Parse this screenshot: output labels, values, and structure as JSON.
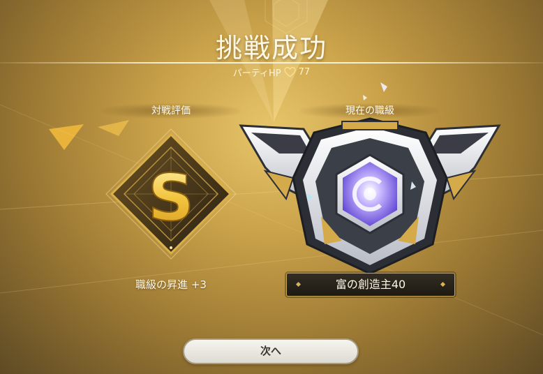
{
  "header": {
    "title": "挑戦成功",
    "party_hp_label": "パーティHP",
    "party_hp_value": "77"
  },
  "battle_rating": {
    "label": "対戦評価",
    "grade": "S",
    "promotion_text": "職級の昇進 +3"
  },
  "current_rank": {
    "label": "現在の職級",
    "rank_name": "富の創造主40"
  },
  "actions": {
    "next_label": "次へ"
  },
  "colors": {
    "gold": "#d9b04a",
    "accent_purple": "#8a6cf0",
    "button_bg": "#f1efe9"
  }
}
